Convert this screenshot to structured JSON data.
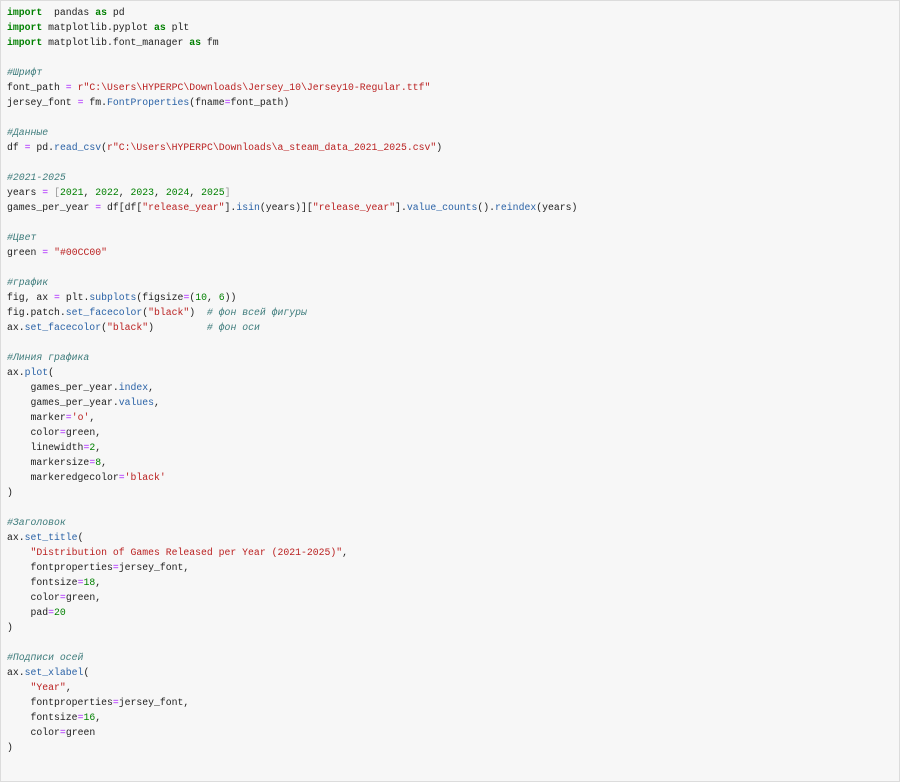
{
  "cell": {
    "lines": [
      [
        [
          "kw",
          "import"
        ],
        [
          "",
          "  pandas "
        ],
        [
          "kw",
          "as"
        ],
        [
          "",
          " pd"
        ]
      ],
      [
        [
          "kw",
          "import"
        ],
        [
          "",
          " matplotlib.pyplot "
        ],
        [
          "kw",
          "as"
        ],
        [
          "",
          " plt"
        ]
      ],
      [
        [
          "kw",
          "import"
        ],
        [
          "",
          " matplotlib.font_manager "
        ],
        [
          "kw",
          "as"
        ],
        [
          "",
          " fm"
        ]
      ],
      [],
      [
        [
          "cm",
          "#Шрифт"
        ]
      ],
      [
        [
          "",
          "font_path "
        ],
        [
          "op",
          "="
        ],
        [
          "",
          " "
        ],
        [
          "str",
          "r\"C:\\Users\\HYPERPC\\Downloads\\Jersey_10\\Jersey10-Regular.ttf\""
        ]
      ],
      [
        [
          "",
          "jersey_font "
        ],
        [
          "op",
          "="
        ],
        [
          "",
          " fm."
        ],
        [
          "fn",
          "FontProperties"
        ],
        [
          "",
          "(fname"
        ],
        [
          "op",
          "="
        ],
        [
          "",
          "font_path)"
        ]
      ],
      [],
      [
        [
          "cm",
          "#Данные"
        ]
      ],
      [
        [
          "",
          "df "
        ],
        [
          "op",
          "="
        ],
        [
          "",
          " pd."
        ],
        [
          "fn",
          "read_csv"
        ],
        [
          "",
          "("
        ],
        [
          "str",
          "r\"C:\\Users\\HYPERPC\\Downloads\\a_steam_data_2021_2025.csv\""
        ],
        [
          "",
          ")"
        ]
      ],
      [],
      [
        [
          "cm",
          "#2021-2025"
        ]
      ],
      [
        [
          "",
          "years "
        ],
        [
          "op",
          "="
        ],
        [
          "",
          " "
        ],
        [
          "br",
          "["
        ],
        [
          "num",
          "2021"
        ],
        [
          "",
          ", "
        ],
        [
          "num",
          "2022"
        ],
        [
          "",
          ", "
        ],
        [
          "num",
          "2023"
        ],
        [
          "",
          ", "
        ],
        [
          "num",
          "2024"
        ],
        [
          "",
          ", "
        ],
        [
          "num",
          "2025"
        ],
        [
          "br",
          "]"
        ]
      ],
      [
        [
          "",
          "games_per_year "
        ],
        [
          "op",
          "="
        ],
        [
          "",
          " df[df["
        ],
        [
          "str",
          "\"release_year\""
        ],
        [
          "",
          "]."
        ],
        [
          "fn",
          "isin"
        ],
        [
          "",
          "(years)]["
        ],
        [
          "str",
          "\"release_year\""
        ],
        [
          "",
          "]."
        ],
        [
          "fn",
          "value_counts"
        ],
        [
          "",
          "()."
        ],
        [
          "fn",
          "reindex"
        ],
        [
          "",
          "(years)"
        ]
      ],
      [],
      [
        [
          "cm",
          "#Цвет"
        ]
      ],
      [
        [
          "",
          "green "
        ],
        [
          "op",
          "="
        ],
        [
          "",
          " "
        ],
        [
          "str",
          "\"#00CC00\""
        ]
      ],
      [],
      [
        [
          "cm",
          "#график"
        ]
      ],
      [
        [
          "",
          "fig, ax "
        ],
        [
          "op",
          "="
        ],
        [
          "",
          " plt."
        ],
        [
          "fn",
          "subplots"
        ],
        [
          "",
          "(figsize"
        ],
        [
          "op",
          "="
        ],
        [
          "",
          "("
        ],
        [
          "num",
          "10"
        ],
        [
          "",
          ", "
        ],
        [
          "num",
          "6"
        ],
        [
          "",
          "))"
        ]
      ],
      [
        [
          "",
          "fig.patch."
        ],
        [
          "fn",
          "set_facecolor"
        ],
        [
          "",
          "("
        ],
        [
          "str",
          "\"black\""
        ],
        [
          "",
          ")  "
        ],
        [
          "cm",
          "# фон всей фигуры"
        ]
      ],
      [
        [
          "",
          "ax."
        ],
        [
          "fn",
          "set_facecolor"
        ],
        [
          "",
          "("
        ],
        [
          "str",
          "\"black\""
        ],
        [
          "",
          ")         "
        ],
        [
          "cm",
          "# фон оси"
        ]
      ],
      [],
      [
        [
          "cm",
          "#Линия графика"
        ]
      ],
      [
        [
          "",
          "ax."
        ],
        [
          "fn",
          "plot"
        ],
        [
          "",
          "("
        ]
      ],
      [
        [
          "",
          "    games_per_year."
        ],
        [
          "fn",
          "index"
        ],
        [
          "",
          ","
        ]
      ],
      [
        [
          "",
          "    games_per_year."
        ],
        [
          "fn",
          "values"
        ],
        [
          "",
          ","
        ]
      ],
      [
        [
          "",
          "    marker"
        ],
        [
          "op",
          "="
        ],
        [
          "str",
          "'o'"
        ],
        [
          "",
          ","
        ]
      ],
      [
        [
          "",
          "    color"
        ],
        [
          "op",
          "="
        ],
        [
          "",
          "green,"
        ]
      ],
      [
        [
          "",
          "    linewidth"
        ],
        [
          "op",
          "="
        ],
        [
          "num",
          "2"
        ],
        [
          "",
          ","
        ]
      ],
      [
        [
          "",
          "    markersize"
        ],
        [
          "op",
          "="
        ],
        [
          "num",
          "8"
        ],
        [
          "",
          ","
        ]
      ],
      [
        [
          "",
          "    markeredgecolor"
        ],
        [
          "op",
          "="
        ],
        [
          "str",
          "'black'"
        ]
      ],
      [
        [
          "",
          ")"
        ]
      ],
      [],
      [
        [
          "cm",
          "#Заголовок"
        ]
      ],
      [
        [
          "",
          "ax."
        ],
        [
          "fn",
          "set_title"
        ],
        [
          "",
          "("
        ]
      ],
      [
        [
          "",
          "    "
        ],
        [
          "str",
          "\"Distribution of Games Released per Year (2021-2025)\""
        ],
        [
          "",
          ","
        ]
      ],
      [
        [
          "",
          "    fontproperties"
        ],
        [
          "op",
          "="
        ],
        [
          "",
          "jersey_font,"
        ]
      ],
      [
        [
          "",
          "    fontsize"
        ],
        [
          "op",
          "="
        ],
        [
          "num",
          "18"
        ],
        [
          "",
          ","
        ]
      ],
      [
        [
          "",
          "    color"
        ],
        [
          "op",
          "="
        ],
        [
          "",
          "green,"
        ]
      ],
      [
        [
          "",
          "    pad"
        ],
        [
          "op",
          "="
        ],
        [
          "num",
          "20"
        ]
      ],
      [
        [
          "",
          ")"
        ]
      ],
      [],
      [
        [
          "cm",
          "#Подписи осей"
        ]
      ],
      [
        [
          "",
          "ax."
        ],
        [
          "fn",
          "set_xlabel"
        ],
        [
          "",
          "("
        ]
      ],
      [
        [
          "",
          "    "
        ],
        [
          "str",
          "\"Year\""
        ],
        [
          "",
          ","
        ]
      ],
      [
        [
          "",
          "    fontproperties"
        ],
        [
          "op",
          "="
        ],
        [
          "",
          "jersey_font,"
        ]
      ],
      [
        [
          "",
          "    fontsize"
        ],
        [
          "op",
          "="
        ],
        [
          "num",
          "16"
        ],
        [
          "",
          ","
        ]
      ],
      [
        [
          "",
          "    color"
        ],
        [
          "op",
          "="
        ],
        [
          "",
          "green"
        ]
      ],
      [
        [
          "",
          ")"
        ]
      ]
    ]
  }
}
